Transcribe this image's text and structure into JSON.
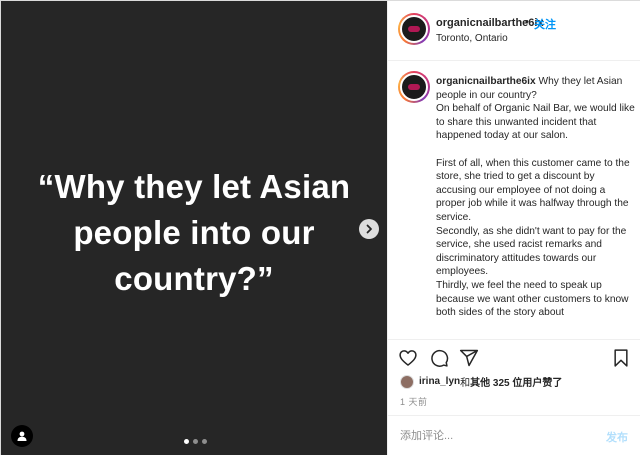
{
  "media": {
    "quote_lines": [
      "“Why they let Asian",
      "people into our",
      "country?”"
    ],
    "slide_index": 1,
    "slide_count": 3
  },
  "header": {
    "username": "organicnailbarthe6ix",
    "separator": "•",
    "follow_label": "关注",
    "location": "Toronto, Ontario"
  },
  "caption": {
    "username": "organicnailbarthe6ix",
    "text": " Why they let Asian people in our country?\nOn behalf of Organic Nail Bar, we would like to share this unwanted incident that happened today at our salon.\n\nFirst of all, when this customer came to the store, she tried to get a discount by accusing our employee of not doing a proper job while it was halfway through the service.\nSecondly, as she didn't want to pay for the service, she used racist remarks and discriminatory attitudes towards our employees.\nThirdly, we feel the need to speak up because we want other customers to know both sides of the story about"
  },
  "likes": {
    "user": "irina_lyn",
    "and": " 和 ",
    "others": "其他 325 位用户",
    "suffix": " 赞了"
  },
  "time_ago": "1 天前",
  "comment": {
    "placeholder": "添加评论...",
    "post_label": "发布"
  },
  "icons": {
    "like": "heart-icon",
    "comment": "comment-icon",
    "share": "share-icon",
    "save": "bookmark-icon",
    "next": "chevron-right-icon",
    "tag": "user-tag-icon"
  },
  "colors": {
    "media_bg": "#262626",
    "link_blue": "#0095f6",
    "post_disabled": "#b2dffc"
  }
}
